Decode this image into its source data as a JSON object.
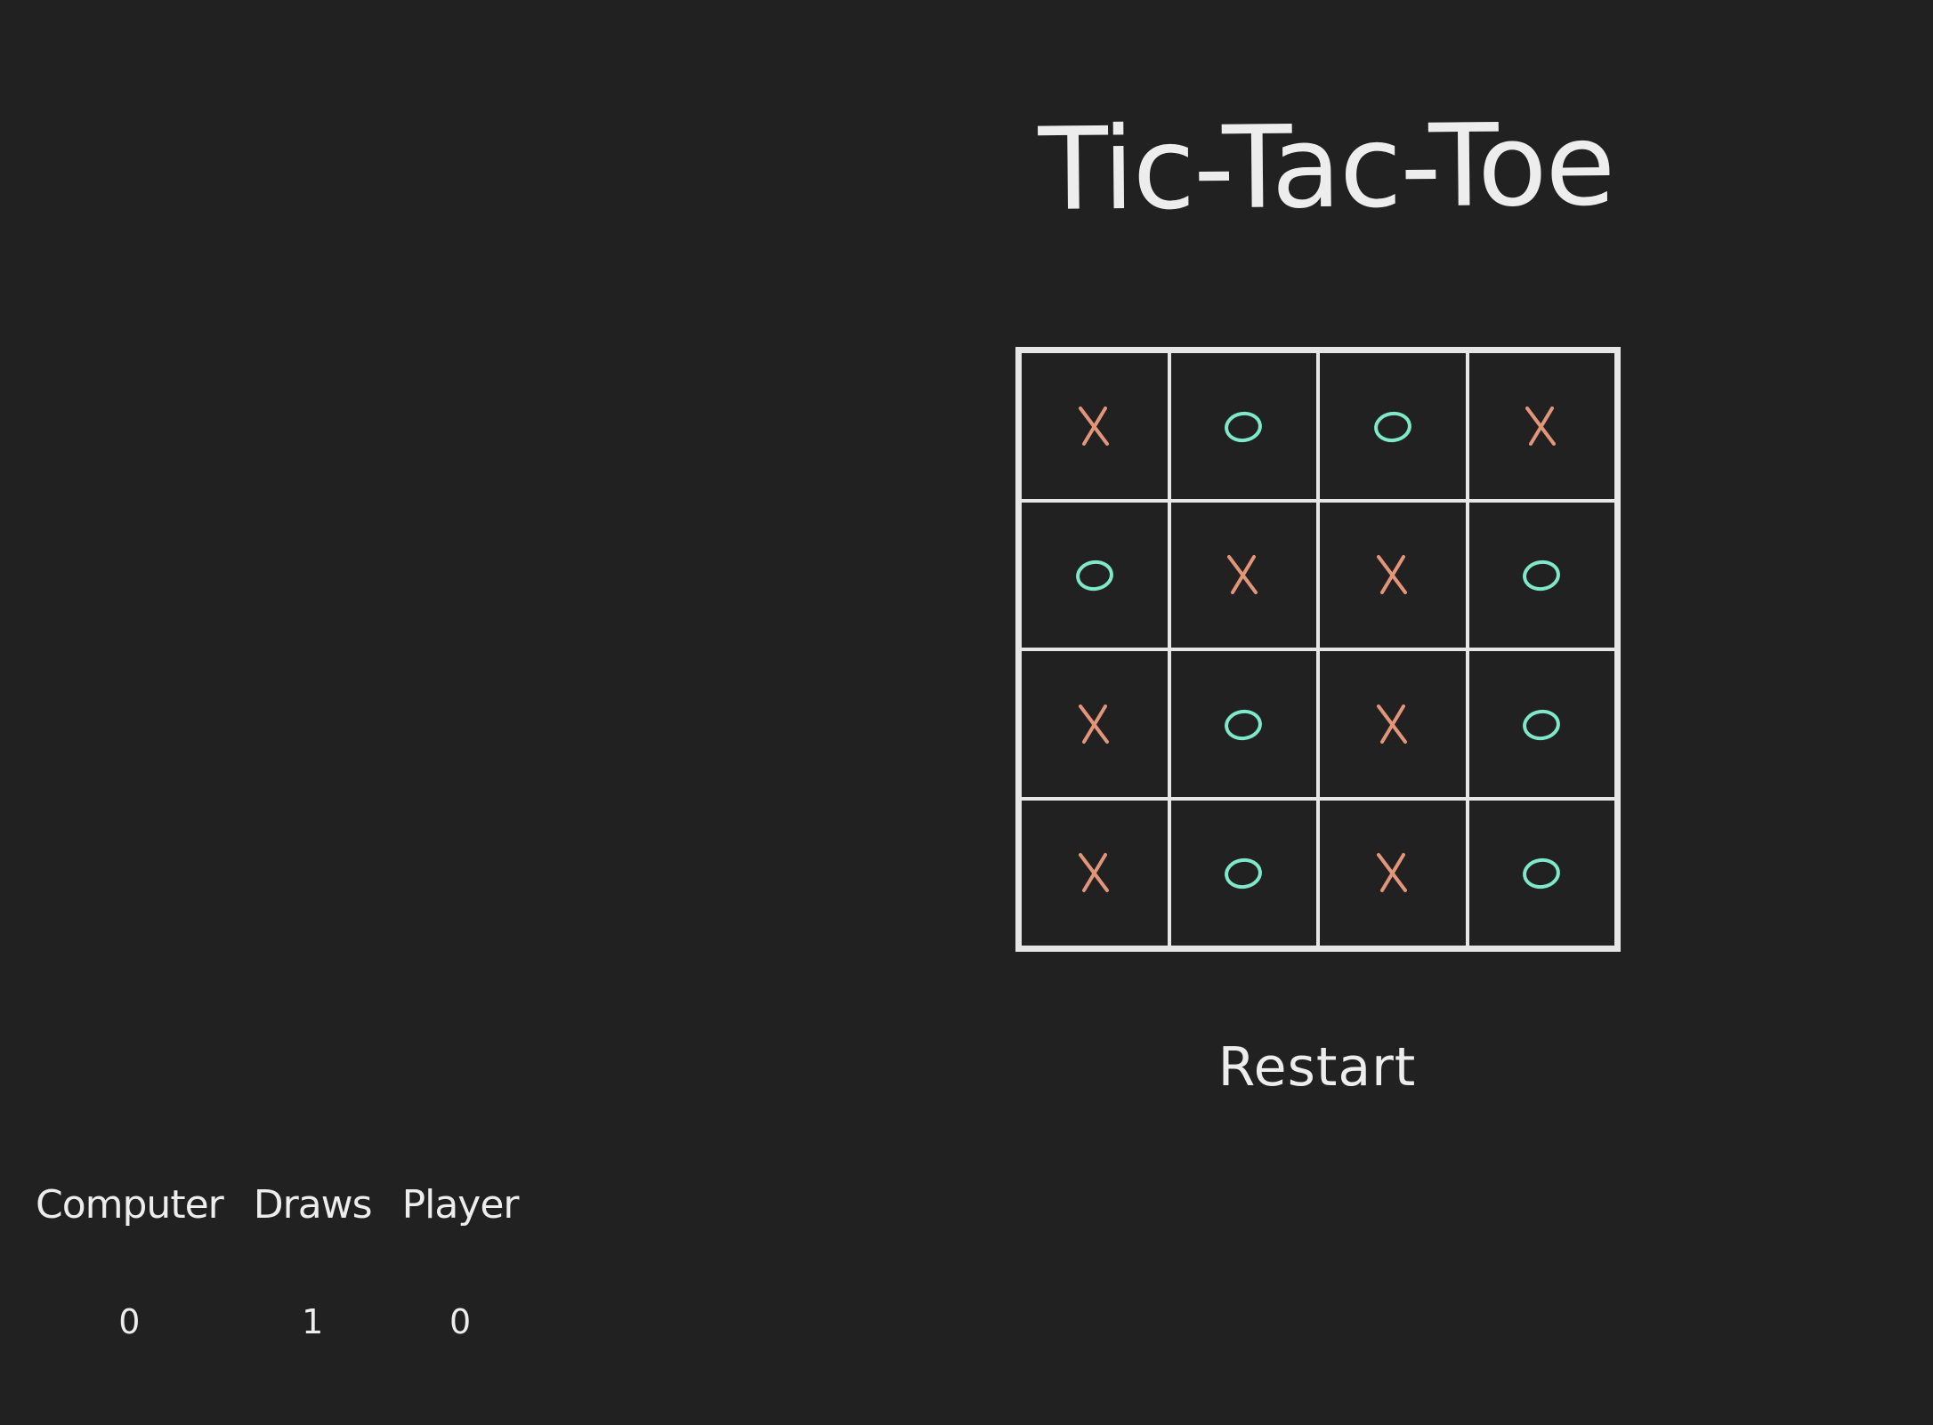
{
  "title": "Tic-Tac-Toe",
  "colors": {
    "background": "#212121",
    "text": "#ededed",
    "grid": "#e6e6e6",
    "x_mark": "#e3957a",
    "o_mark": "#7ee8c8"
  },
  "board": {
    "size": 4,
    "cells": [
      "X",
      "O",
      "O",
      "X",
      "O",
      "X",
      "X",
      "O",
      "X",
      "O",
      "X",
      "O",
      "X",
      "O",
      "X",
      "O"
    ]
  },
  "restart_label": "Restart",
  "scores": [
    {
      "label": "Computer",
      "value": "0"
    },
    {
      "label": "Draws",
      "value": "1"
    },
    {
      "label": "Player",
      "value": "0"
    }
  ]
}
